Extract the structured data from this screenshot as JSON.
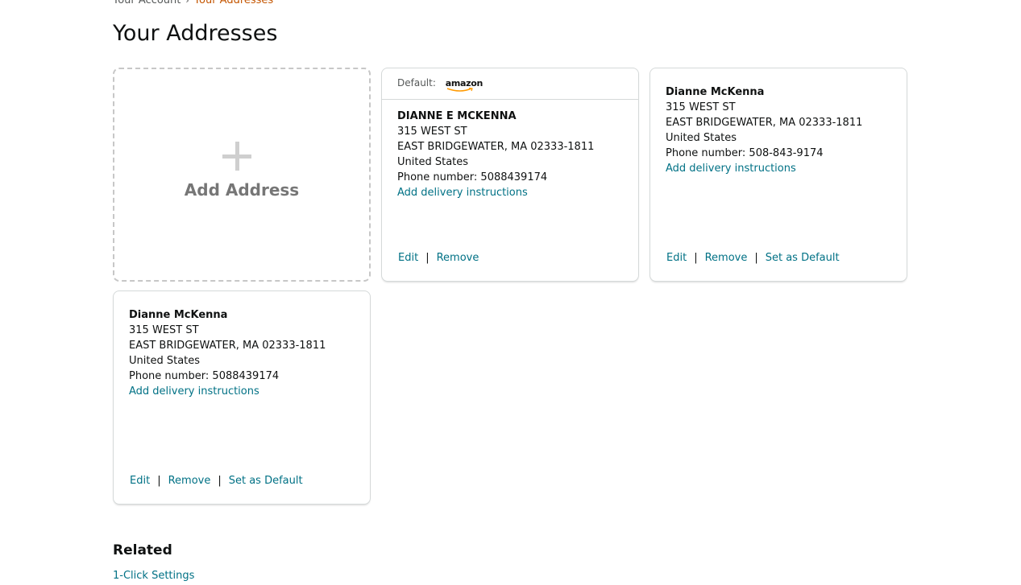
{
  "breadcrumb": {
    "parent": "Your Account",
    "separator": "›",
    "current": "Your Addresses"
  },
  "page_title": "Your Addresses",
  "add_address": {
    "label": "Add Address",
    "icon": "plus-icon"
  },
  "default_card": {
    "header_label": "Default:",
    "logo_text": "amazon",
    "name": "DIANNE E MCKENNA",
    "street": "315 WEST ST",
    "city_line": "EAST BRIDGEWATER, MA 02333-1811",
    "country": "United States",
    "phone": "Phone number: 5088439174",
    "delivery_link": "Add delivery instructions",
    "edit": "Edit",
    "remove": "Remove"
  },
  "address_2": {
    "name": "Dianne McKenna",
    "street": "315 WEST ST",
    "city_line": "EAST BRIDGEWATER, MA 02333-1811",
    "country": "United States",
    "phone": "Phone number: 508-843-9174",
    "delivery_link": "Add delivery instructions",
    "edit": "Edit",
    "remove": "Remove",
    "set_default": "Set as Default"
  },
  "address_3": {
    "name": "Dianne McKenna",
    "street": "315 WEST ST",
    "city_line": "EAST BRIDGEWATER, MA 02333-1811",
    "country": "United States",
    "phone": "Phone number: 5088439174",
    "delivery_link": "Add delivery instructions",
    "edit": "Edit",
    "remove": "Remove",
    "set_default": "Set as Default"
  },
  "separator": "|",
  "related": {
    "title": "Related",
    "link": "1-Click Settings"
  },
  "colors": {
    "link": "#007185",
    "breadcrumb_current": "#c45500",
    "text": "#0f1111",
    "card_border": "#d5d9d9",
    "amazon_smile": "#ff9900"
  }
}
